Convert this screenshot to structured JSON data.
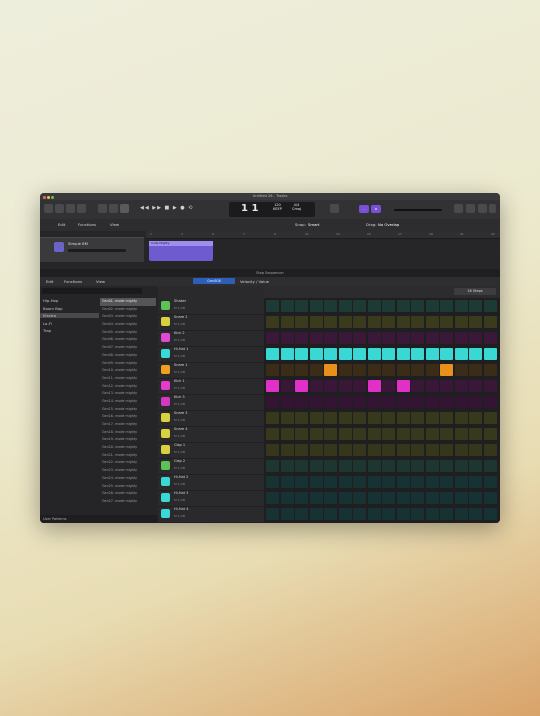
{
  "window": {
    "title": "Untitled 26 - Tracks"
  },
  "toolbar": {
    "transport_glyphs": "◀◀ ▶▶ ■ ▶ ● ⟲",
    "lcd": {
      "bar": "1",
      "beat": "1",
      "tempo": "120",
      "tempo_mode": "KEEP",
      "time_sig": "4/4",
      "key": "Cmaj"
    },
    "purple_btns": [
      "⋯",
      "⚙"
    ]
  },
  "menubar": {
    "items": [
      "Edit",
      "Functions",
      "View"
    ],
    "snap_label": "Snap:",
    "snap_value": "Smart",
    "drag_label": "Drag:",
    "drag_value": "No Overlap"
  },
  "ruler": {
    "marks": [
      "1",
      "3",
      "5",
      "7",
      "9",
      "11",
      "13",
      "15",
      "17",
      "19",
      "21",
      "23"
    ]
  },
  "track": {
    "name": "Simple 8M",
    "region_name": "Indie Mighty"
  },
  "sequencer": {
    "title": "Step Sequencer",
    "menu": [
      "Edit",
      "Functions",
      "View"
    ],
    "pattern_name": "Gen808",
    "mode_label": "Velocity / Value",
    "steps_label": "16 Steps"
  },
  "browser": {
    "categories": [
      "Hip-Hop",
      "Boom Bap",
      "Electro",
      "Lo-Fi",
      "Trap"
    ],
    "selected_category_index": 2,
    "files": [
      "Gen01- mode mighty",
      "Gen02- mode mighty",
      "Gen03- mode mighty",
      "Gen04- mode mighty",
      "Gen05- mode mighty",
      "Gen06- mode mighty",
      "Gen07- mode mighty",
      "Gen08- mode mighty",
      "Gen09- mode mighty",
      "Gen10- mode mighty",
      "Gen11- mode mighty",
      "Gen12- mode mighty",
      "Gen13- mode mighty",
      "Gen14- mode mighty",
      "Gen15- mode mighty",
      "Gen16- mode mighty",
      "Gen17- mode mighty",
      "Gen18- mode mighty",
      "Gen19- mode mighty",
      "Gen20- mode mighty",
      "Gen21- mode mighty",
      "Gen22- mode mighty",
      "Gen23- mode mighty",
      "Gen24- mode mighty",
      "Gen25- mode mighty",
      "Gen26- mode mighty",
      "Gen27- mode mighty"
    ],
    "selected_file_index": 0,
    "footer": "User   Patterns"
  },
  "rows": [
    {
      "name": "Shaker",
      "color": "#4fb84a",
      "icon_color": "#5cc255",
      "active": [],
      "cell_color": "#1d3a34"
    },
    {
      "name": "Snare 2",
      "color": "#c6c23a",
      "icon_color": "#d8d240",
      "active": [],
      "cell_color": "#3a3a1c"
    },
    {
      "name": "Kick 2",
      "color": "#d238c4",
      "icon_color": "#e04ad2",
      "active": [],
      "cell_color": "#3a1838"
    },
    {
      "name": "Hi-Hat 1",
      "color": "#3ad8d4",
      "icon_color": "#3ad8d4",
      "active": [
        0,
        1,
        2,
        3,
        4,
        5,
        6,
        7,
        8,
        9,
        10,
        11,
        12,
        13,
        14,
        15
      ],
      "cell_color": "#1c3a3a"
    },
    {
      "name": "Snare 1",
      "color": "#e8901a",
      "icon_color": "#f0a020",
      "active": [
        4,
        12
      ],
      "cell_color": "#3a2c16"
    },
    {
      "name": "Kick 1",
      "color": "#e030c8",
      "icon_color": "#e43ace",
      "active": [
        0,
        2,
        7,
        9
      ],
      "cell_color": "#3a1638"
    },
    {
      "name": "Kick 3",
      "color": "#d238c4",
      "icon_color": "#d238c4",
      "active": [],
      "cell_color": "#331533"
    },
    {
      "name": "Snare 3",
      "color": "#c6c23a",
      "icon_color": "#d8d240",
      "active": [],
      "cell_color": "#38381c"
    },
    {
      "name": "Snare 4",
      "color": "#c6c23a",
      "icon_color": "#d8d240",
      "active": [],
      "cell_color": "#38381c"
    },
    {
      "name": "Clap 1",
      "color": "#c6c23a",
      "icon_color": "#d8d240",
      "active": [],
      "cell_color": "#36361c"
    },
    {
      "name": "Clap 2",
      "color": "#4fb84a",
      "icon_color": "#5cc255",
      "active": [],
      "cell_color": "#1d3630"
    },
    {
      "name": "Hi-Hat 2",
      "color": "#3ad8d4",
      "icon_color": "#3ad8d4",
      "active": [],
      "cell_color": "#173232"
    },
    {
      "name": "Hi-Hat 3",
      "color": "#3ad8d4",
      "icon_color": "#3ad8d4",
      "active": [],
      "cell_color": "#173232"
    },
    {
      "name": "Hi-Hat 4",
      "color": "#3ad8d4",
      "icon_color": "#3ad8d4",
      "active": [],
      "cell_color": "#173232"
    }
  ],
  "row_controls": {
    "mute": "M",
    "solo": "S",
    "value_label": "ON"
  },
  "icons": {
    "traffic_lights": [
      "#ed6a5e",
      "#f5bf4f",
      "#62c554"
    ]
  }
}
